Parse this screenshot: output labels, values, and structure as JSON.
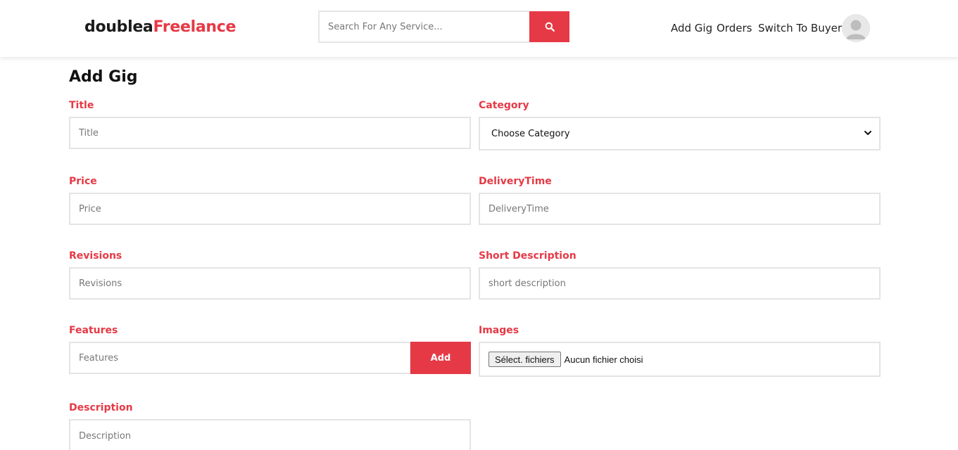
{
  "header": {
    "logo_part1": "doublea",
    "logo_part2": "Freelance",
    "search_placeholder": "Search For Any Service...",
    "nav": {
      "add_gig": "Add Gig",
      "orders": "Orders",
      "switch": "Switch To Buyer"
    }
  },
  "page": {
    "title": "Add Gig"
  },
  "form": {
    "title": {
      "label": "Title",
      "placeholder": "Title"
    },
    "category": {
      "label": "Category",
      "selected": "Choose Category"
    },
    "price": {
      "label": "Price",
      "placeholder": "Price"
    },
    "delivery": {
      "label": "DeliveryTime",
      "placeholder": "DeliveryTime"
    },
    "revisions": {
      "label": "Revisions",
      "placeholder": "Revisions"
    },
    "short_desc": {
      "label": "Short Description",
      "placeholder": "short description"
    },
    "features": {
      "label": "Features",
      "placeholder": "Features",
      "add_label": "Add"
    },
    "images": {
      "label": "Images",
      "button_label": "Sélect. fichiers",
      "status": "Aucun fichier choisi"
    },
    "description": {
      "label": "Description",
      "placeholder": "Description"
    }
  },
  "colors": {
    "accent": "#e63946",
    "border": "#e4e4e4"
  },
  "icons": {
    "search": "search-icon",
    "avatar": "user-avatar-icon",
    "chevron": "chevron-down-icon"
  }
}
